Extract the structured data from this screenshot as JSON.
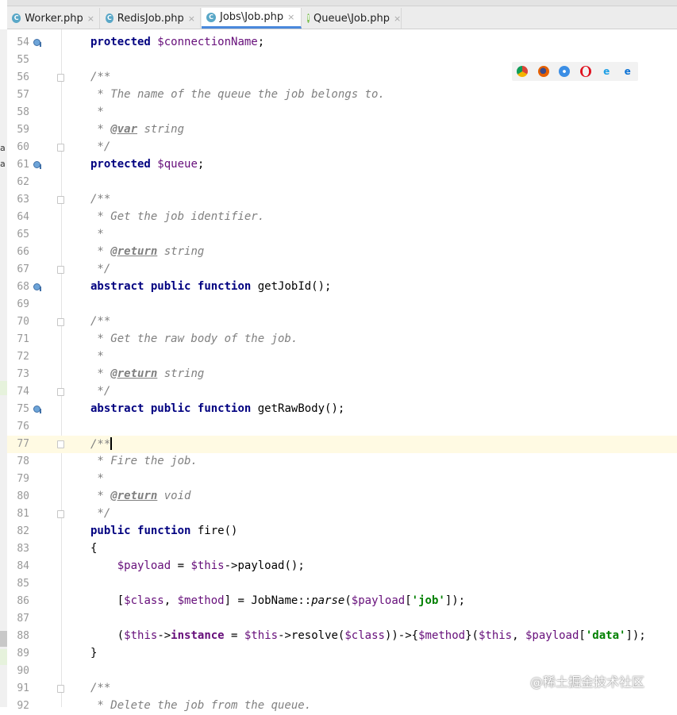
{
  "tabs": [
    {
      "label": "Worker.php",
      "icon": "C",
      "active": false
    },
    {
      "label": "RedisJob.php",
      "icon": "C",
      "active": false
    },
    {
      "label": "Jobs\\Job.php",
      "icon": "C",
      "active": true
    },
    {
      "label": "Queue\\Job.php",
      "icon": "I",
      "active": false
    }
  ],
  "close_glyph": "×",
  "left_cut_text": [
    "a",
    "a"
  ],
  "browser_icons": [
    "chrome-icon",
    "firefox-icon",
    "safari-icon",
    "opera-icon",
    "ie-icon",
    "edge-icon"
  ],
  "current_line": "77",
  "lines": [
    {
      "n": "54",
      "code": "protected $connectionName;"
    },
    {
      "n": "55",
      "code": ""
    },
    {
      "n": "56",
      "code": "/**"
    },
    {
      "n": "57",
      "code": " * The name of the queue the job belongs to."
    },
    {
      "n": "58",
      "code": " *"
    },
    {
      "n": "59",
      "code": " * @var string"
    },
    {
      "n": "60",
      "code": " */"
    },
    {
      "n": "61",
      "code": "protected $queue;"
    },
    {
      "n": "62",
      "code": ""
    },
    {
      "n": "63",
      "code": "/**"
    },
    {
      "n": "64",
      "code": " * Get the job identifier."
    },
    {
      "n": "65",
      "code": " *"
    },
    {
      "n": "66",
      "code": " * @return string"
    },
    {
      "n": "67",
      "code": " */"
    },
    {
      "n": "68",
      "code": "abstract public function getJobId();"
    },
    {
      "n": "69",
      "code": ""
    },
    {
      "n": "70",
      "code": "/**"
    },
    {
      "n": "71",
      "code": " * Get the raw body of the job."
    },
    {
      "n": "72",
      "code": " *"
    },
    {
      "n": "73",
      "code": " * @return string"
    },
    {
      "n": "74",
      "code": " */"
    },
    {
      "n": "75",
      "code": "abstract public function getRawBody();"
    },
    {
      "n": "76",
      "code": ""
    },
    {
      "n": "77",
      "code": "/**"
    },
    {
      "n": "78",
      "code": " * Fire the job."
    },
    {
      "n": "79",
      "code": " *"
    },
    {
      "n": "80",
      "code": " * @return void"
    },
    {
      "n": "81",
      "code": " */"
    },
    {
      "n": "82",
      "code": "public function fire()"
    },
    {
      "n": "83",
      "code": "{"
    },
    {
      "n": "84",
      "code": "    $payload = $this->payload();"
    },
    {
      "n": "85",
      "code": ""
    },
    {
      "n": "86",
      "code": "    [$class, $method] = JobName::parse($payload['job']);"
    },
    {
      "n": "87",
      "code": ""
    },
    {
      "n": "88",
      "code": "    ($this->instance = $this->resolve($class))->{$method}($this, $payload['data']);"
    },
    {
      "n": "89",
      "code": "}"
    },
    {
      "n": "90",
      "code": ""
    },
    {
      "n": "91",
      "code": "/**"
    },
    {
      "n": "92",
      "code": " * Delete the job from the queue."
    }
  ],
  "watermark": "@稀土掘金技术社区",
  "colors": {
    "keyword": "#000080",
    "variable": "#660e7a",
    "comment": "#808080",
    "string": "#008000",
    "current_line_bg": "#fffae3",
    "tab_active_underline": "#4a89dc"
  }
}
